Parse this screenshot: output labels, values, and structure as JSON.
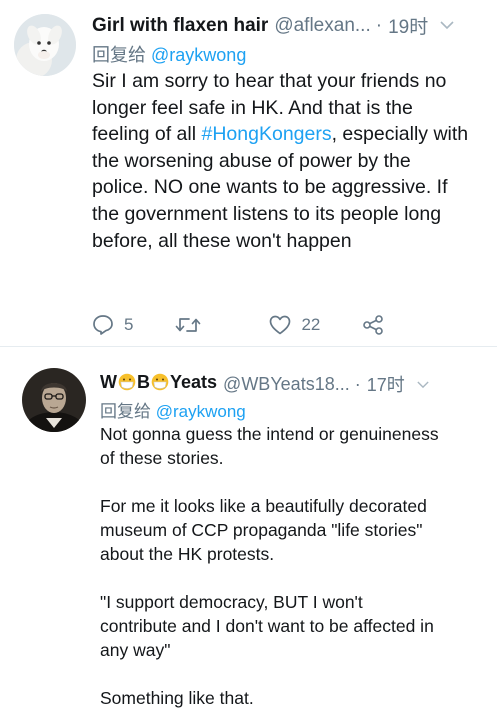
{
  "tweets": [
    {
      "display_name": "Girl with flaxen hair",
      "handle": "@aflexan...",
      "separator": "·",
      "time": "19时",
      "replying_prefix": "回复给",
      "replying_to": "@raykwong",
      "text_before_hashtag": "Sir I am sorry to hear that your friends no longer feel safe in HK. And that is the feeling of all ",
      "hashtag": "#HongKongers",
      "text_after_hashtag": ", especially with the worsening abuse of power by the police. NO one wants to be aggressive. If the government listens to its people long before, all these won't happen",
      "reply_count": "5",
      "like_count": "22"
    },
    {
      "display_name_part1": "W",
      "display_name_part2": "B",
      "display_name_part3": "Yeats",
      "handle": "@WBYeats18...",
      "separator": "·",
      "time": "17时",
      "replying_prefix": "回复给",
      "replying_to": "@raykwong",
      "paragraphs": [
        "Not gonna guess the intend or genuineness of these stories.",
        "For me it looks like a beautifully decorated museum of CCP propaganda \"life stories\" about the HK protests.",
        "\"I support democracy, BUT I won't contribute and I don't want to be affected in any way\"",
        "Something like that."
      ]
    }
  ],
  "colors": {
    "accent": "#1da1f2",
    "muted": "#657786",
    "text": "#14171a",
    "divider": "#e6ecf0"
  },
  "icons": {
    "reply": "reply-icon",
    "retweet": "retweet-icon",
    "like": "heart-icon",
    "share": "share-icon",
    "more": "chevron-down-icon",
    "emoji": "face-with-medical-mask-emoji"
  }
}
